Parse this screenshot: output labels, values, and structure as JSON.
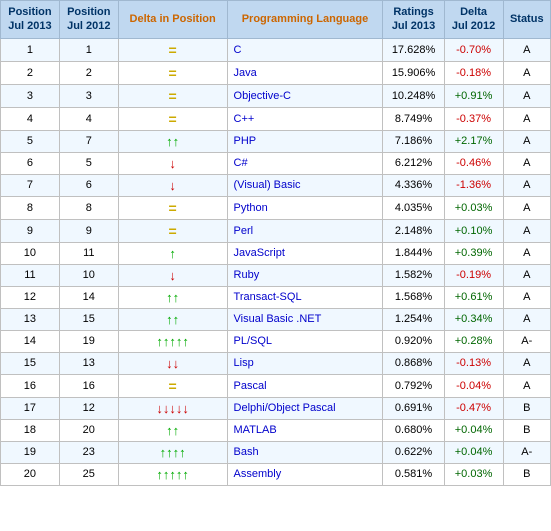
{
  "table": {
    "headers": [
      {
        "label": "Position\nJul 2013",
        "label_line1": "Position",
        "label_line2": "Jul 2013"
      },
      {
        "label": "Position\nJul 2012",
        "label_line1": "Position",
        "label_line2": "Jul 2012"
      },
      {
        "label": "Delta in Position",
        "label_line1": "Delta in Position",
        "label_line2": ""
      },
      {
        "label": "Programming Language",
        "label_line1": "Programming Language",
        "label_line2": ""
      },
      {
        "label": "Ratings\nJul 2013",
        "label_line1": "Ratings",
        "label_line2": "Jul 2013"
      },
      {
        "label": "Delta\nJul 2012",
        "label_line1": "Delta",
        "label_line2": "Jul 2012"
      },
      {
        "label": "Status",
        "label_line1": "Status",
        "label_line2": ""
      }
    ],
    "rows": [
      {
        "pos2013": "1",
        "pos2012": "1",
        "delta_type": "equal",
        "delta_arrows": "=",
        "lang": "C",
        "rating": "17.628%",
        "delta_rating": "-0.70%",
        "status": "A"
      },
      {
        "pos2013": "2",
        "pos2012": "2",
        "delta_type": "equal",
        "delta_arrows": "=",
        "lang": "Java",
        "rating": "15.906%",
        "delta_rating": "-0.18%",
        "status": "A"
      },
      {
        "pos2013": "3",
        "pos2012": "3",
        "delta_type": "equal",
        "delta_arrows": "=",
        "lang": "Objective-C",
        "rating": "10.248%",
        "delta_rating": "+0.91%",
        "status": "A"
      },
      {
        "pos2013": "4",
        "pos2012": "4",
        "delta_type": "equal",
        "delta_arrows": "=",
        "lang": "C++",
        "rating": "8.749%",
        "delta_rating": "-0.37%",
        "status": "A"
      },
      {
        "pos2013": "5",
        "pos2012": "7",
        "delta_type": "up2",
        "delta_arrows": "↑↑",
        "lang": "PHP",
        "rating": "7.186%",
        "delta_rating": "+2.17%",
        "status": "A"
      },
      {
        "pos2013": "6",
        "pos2012": "5",
        "delta_type": "down1",
        "delta_arrows": "↓",
        "lang": "C#",
        "rating": "6.212%",
        "delta_rating": "-0.46%",
        "status": "A"
      },
      {
        "pos2013": "7",
        "pos2012": "6",
        "delta_type": "down1",
        "delta_arrows": "↓",
        "lang": "(Visual) Basic",
        "rating": "4.336%",
        "delta_rating": "-1.36%",
        "status": "A"
      },
      {
        "pos2013": "8",
        "pos2012": "8",
        "delta_type": "equal",
        "delta_arrows": "=",
        "lang": "Python",
        "rating": "4.035%",
        "delta_rating": "+0.03%",
        "status": "A"
      },
      {
        "pos2013": "9",
        "pos2012": "9",
        "delta_type": "equal",
        "delta_arrows": "=",
        "lang": "Perl",
        "rating": "2.148%",
        "delta_rating": "+0.10%",
        "status": "A"
      },
      {
        "pos2013": "10",
        "pos2012": "11",
        "delta_type": "up1",
        "delta_arrows": "↑",
        "lang": "JavaScript",
        "rating": "1.844%",
        "delta_rating": "+0.39%",
        "status": "A"
      },
      {
        "pos2013": "11",
        "pos2012": "10",
        "delta_type": "down1",
        "delta_arrows": "↓",
        "lang": "Ruby",
        "rating": "1.582%",
        "delta_rating": "-0.19%",
        "status": "A"
      },
      {
        "pos2013": "12",
        "pos2012": "14",
        "delta_type": "up2",
        "delta_arrows": "↑↑",
        "lang": "Transact-SQL",
        "rating": "1.568%",
        "delta_rating": "+0.61%",
        "status": "A"
      },
      {
        "pos2013": "13",
        "pos2012": "15",
        "delta_type": "up2",
        "delta_arrows": "↑↑",
        "lang": "Visual Basic .NET",
        "rating": "1.254%",
        "delta_rating": "+0.34%",
        "status": "A"
      },
      {
        "pos2013": "14",
        "pos2012": "19",
        "delta_type": "up5",
        "delta_arrows": "↑↑↑↑↑",
        "lang": "PL/SQL",
        "rating": "0.920%",
        "delta_rating": "+0.28%",
        "status": "A-"
      },
      {
        "pos2013": "15",
        "pos2012": "13",
        "delta_type": "down2",
        "delta_arrows": "↓↓",
        "lang": "Lisp",
        "rating": "0.868%",
        "delta_rating": "-0.13%",
        "status": "A"
      },
      {
        "pos2013": "16",
        "pos2012": "16",
        "delta_type": "equal",
        "delta_arrows": "=",
        "lang": "Pascal",
        "rating": "0.792%",
        "delta_rating": "-0.04%",
        "status": "A"
      },
      {
        "pos2013": "17",
        "pos2012": "12",
        "delta_type": "down5",
        "delta_arrows": "↓↓↓↓↓",
        "lang": "Delphi/Object Pascal",
        "rating": "0.691%",
        "delta_rating": "-0.47%",
        "status": "B"
      },
      {
        "pos2013": "18",
        "pos2012": "20",
        "delta_type": "up2",
        "delta_arrows": "↑↑",
        "lang": "MATLAB",
        "rating": "0.680%",
        "delta_rating": "+0.04%",
        "status": "B"
      },
      {
        "pos2013": "19",
        "pos2012": "23",
        "delta_type": "up4",
        "delta_arrows": "↑↑↑↑",
        "lang": "Bash",
        "rating": "0.622%",
        "delta_rating": "+0.04%",
        "status": "A-"
      },
      {
        "pos2013": "20",
        "pos2012": "25",
        "delta_type": "up5",
        "delta_arrows": "↑↑↑↑↑",
        "lang": "Assembly",
        "rating": "0.581%",
        "delta_rating": "+0.03%",
        "status": "B"
      }
    ]
  }
}
